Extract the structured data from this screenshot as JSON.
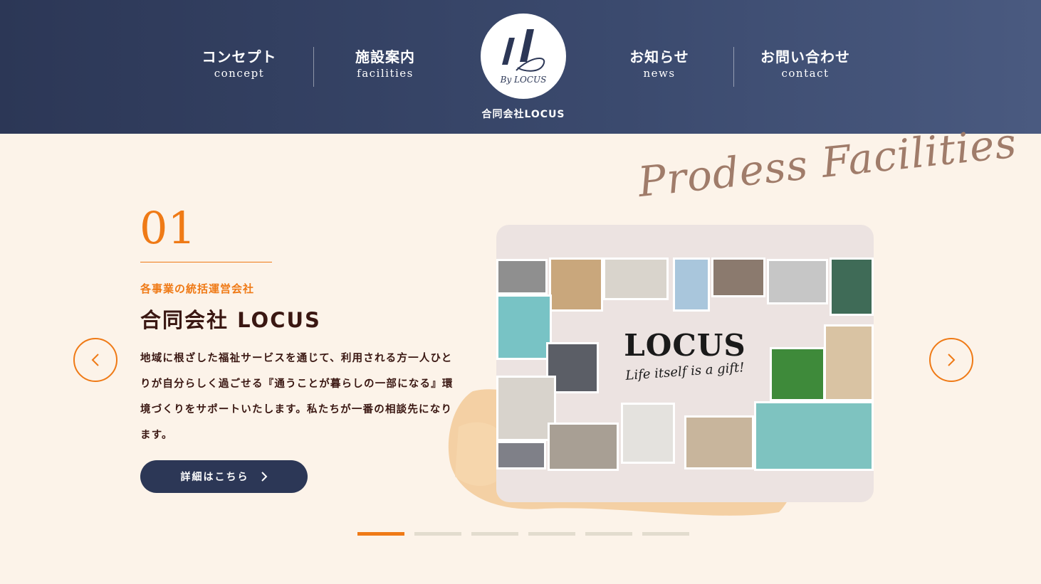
{
  "nav": [
    {
      "jp": "コンセプト",
      "en": "concept"
    },
    {
      "jp": "施設案内",
      "en": "facilities"
    },
    {
      "jp": "お知らせ",
      "en": "news"
    },
    {
      "jp": "お問い合わせ",
      "en": "contact"
    }
  ],
  "logo": {
    "mark": "L",
    "sub": "By LOCUS",
    "name": "合同会社LOCUS"
  },
  "slide": {
    "number": "01",
    "subtitle": "各事業の統括運営会社",
    "title": "合同会社 LOCUS",
    "body": "地域に根ざした福祉サービスを通じて、利用される方一人ひとりが自分らしく過ごせる『通うことが暮らしの一部になる』環境づくりをサポートいたします。私たちが一番の相談先になります。",
    "button_label": "詳細はこちら"
  },
  "collage": {
    "script_heading": "Prodess Facilities",
    "brand": "LOCUS",
    "tagline": "Life itself is a gift!"
  },
  "pagination": {
    "count": 6,
    "active_index": 0
  },
  "colors": {
    "navy": "#2c3756",
    "orange": "#ef7a16",
    "cream": "#fcf3e9",
    "brown_text": "#3a1712"
  },
  "icons": {
    "prev": "chevron-left-icon",
    "next": "chevron-right-icon",
    "button": "chevron-right-icon"
  }
}
